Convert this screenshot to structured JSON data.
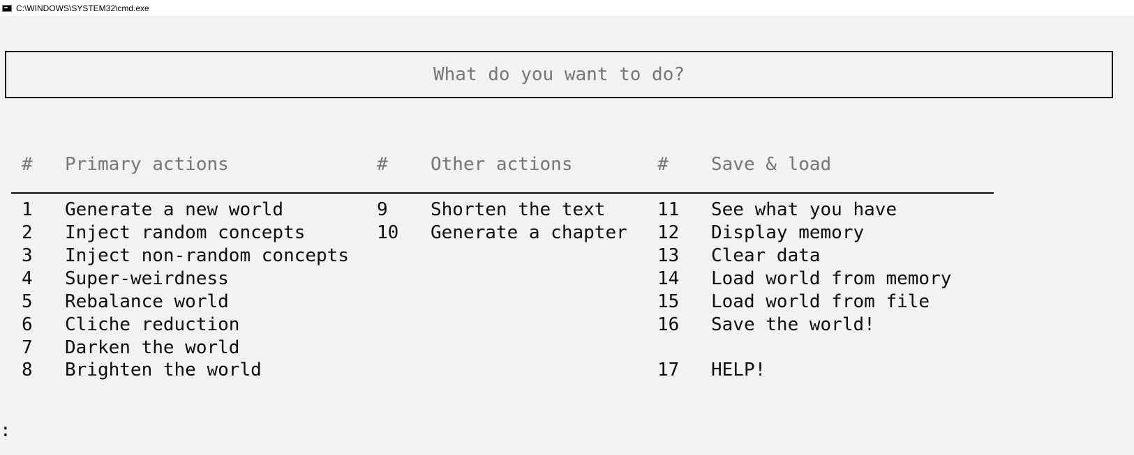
{
  "window": {
    "title": "C:\\WINDOWS\\SYSTEM32\\cmd.exe",
    "icon": "cmd-icon"
  },
  "banner": {
    "text": "What do you want to do?"
  },
  "table": {
    "headers": {
      "num1": "#",
      "primary": "Primary actions",
      "num2": "#",
      "other": "Other actions",
      "num3": "#",
      "save": "Save & load"
    },
    "primary": [
      {
        "num": "1",
        "label": "Generate a new world"
      },
      {
        "num": "2",
        "label": "Inject random concepts"
      },
      {
        "num": "3",
        "label": "Inject non-random concepts"
      },
      {
        "num": "4",
        "label": "Super-weirdness"
      },
      {
        "num": "5",
        "label": "Rebalance world"
      },
      {
        "num": "6",
        "label": "Cliche reduction"
      },
      {
        "num": "7",
        "label": "Darken the world"
      },
      {
        "num": "8",
        "label": "Brighten the world"
      }
    ],
    "other": [
      {
        "num": "9",
        "label": "Shorten the text"
      },
      {
        "num": "10",
        "label": "Generate a chapter"
      }
    ],
    "save": [
      {
        "num": "11",
        "label": "See what you have"
      },
      {
        "num": "12",
        "label": "Display memory"
      },
      {
        "num": "13",
        "label": "Clear data"
      },
      {
        "num": "14",
        "label": "Load world from memory"
      },
      {
        "num": "15",
        "label": "Load world from file"
      },
      {
        "num": "16",
        "label": "Save the world!"
      },
      {
        "num": "17",
        "label": "HELP!"
      }
    ]
  },
  "prompt": {
    "text": ":"
  }
}
